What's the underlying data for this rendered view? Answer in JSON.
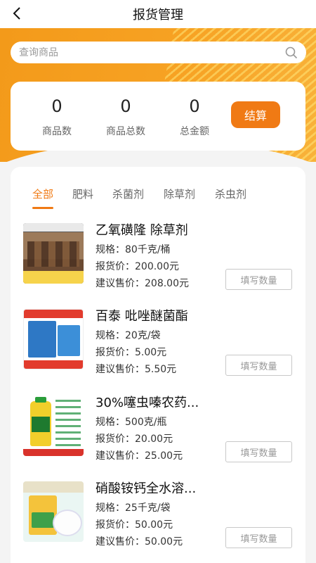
{
  "header": {
    "title": "报货管理"
  },
  "search": {
    "placeholder": "查询商品"
  },
  "summary": {
    "stats": [
      {
        "value": "0",
        "label": "商品数"
      },
      {
        "value": "0",
        "label": "商品总数"
      },
      {
        "value": "0",
        "label": "总金额"
      }
    ],
    "settle_label": "结算"
  },
  "tabs": [
    "全部",
    "肥料",
    "杀菌剂",
    "除草剂",
    "杀虫剂"
  ],
  "active_tab": "全部",
  "products": [
    {
      "name": "乙氧磺隆 除草剂",
      "spec": "规格：80千克/桶",
      "report_price": "报货价：200.00元",
      "suggested_price": "建议售价：208.00元",
      "button": "填写数量"
    },
    {
      "name": "百泰 吡唑醚菌酯",
      "spec": "规格：20克/袋",
      "report_price": "报货价：5.00元",
      "suggested_price": "建议售价：5.50元",
      "button": "填写数量"
    },
    {
      "name": "30%噻虫嗪农药...",
      "spec": "规格：500克/瓶",
      "report_price": "报货价：20.00元",
      "suggested_price": "建议售价：25.00元",
      "button": "填写数量"
    },
    {
      "name": "硝酸铵钙全水溶...",
      "spec": "规格：25千克/袋",
      "report_price": "报货价：50.00元",
      "suggested_price": "建议售价：50.00元",
      "button": "填写数量"
    }
  ],
  "colors": {
    "accent": "#f07a14",
    "hero": "#f7a223"
  }
}
